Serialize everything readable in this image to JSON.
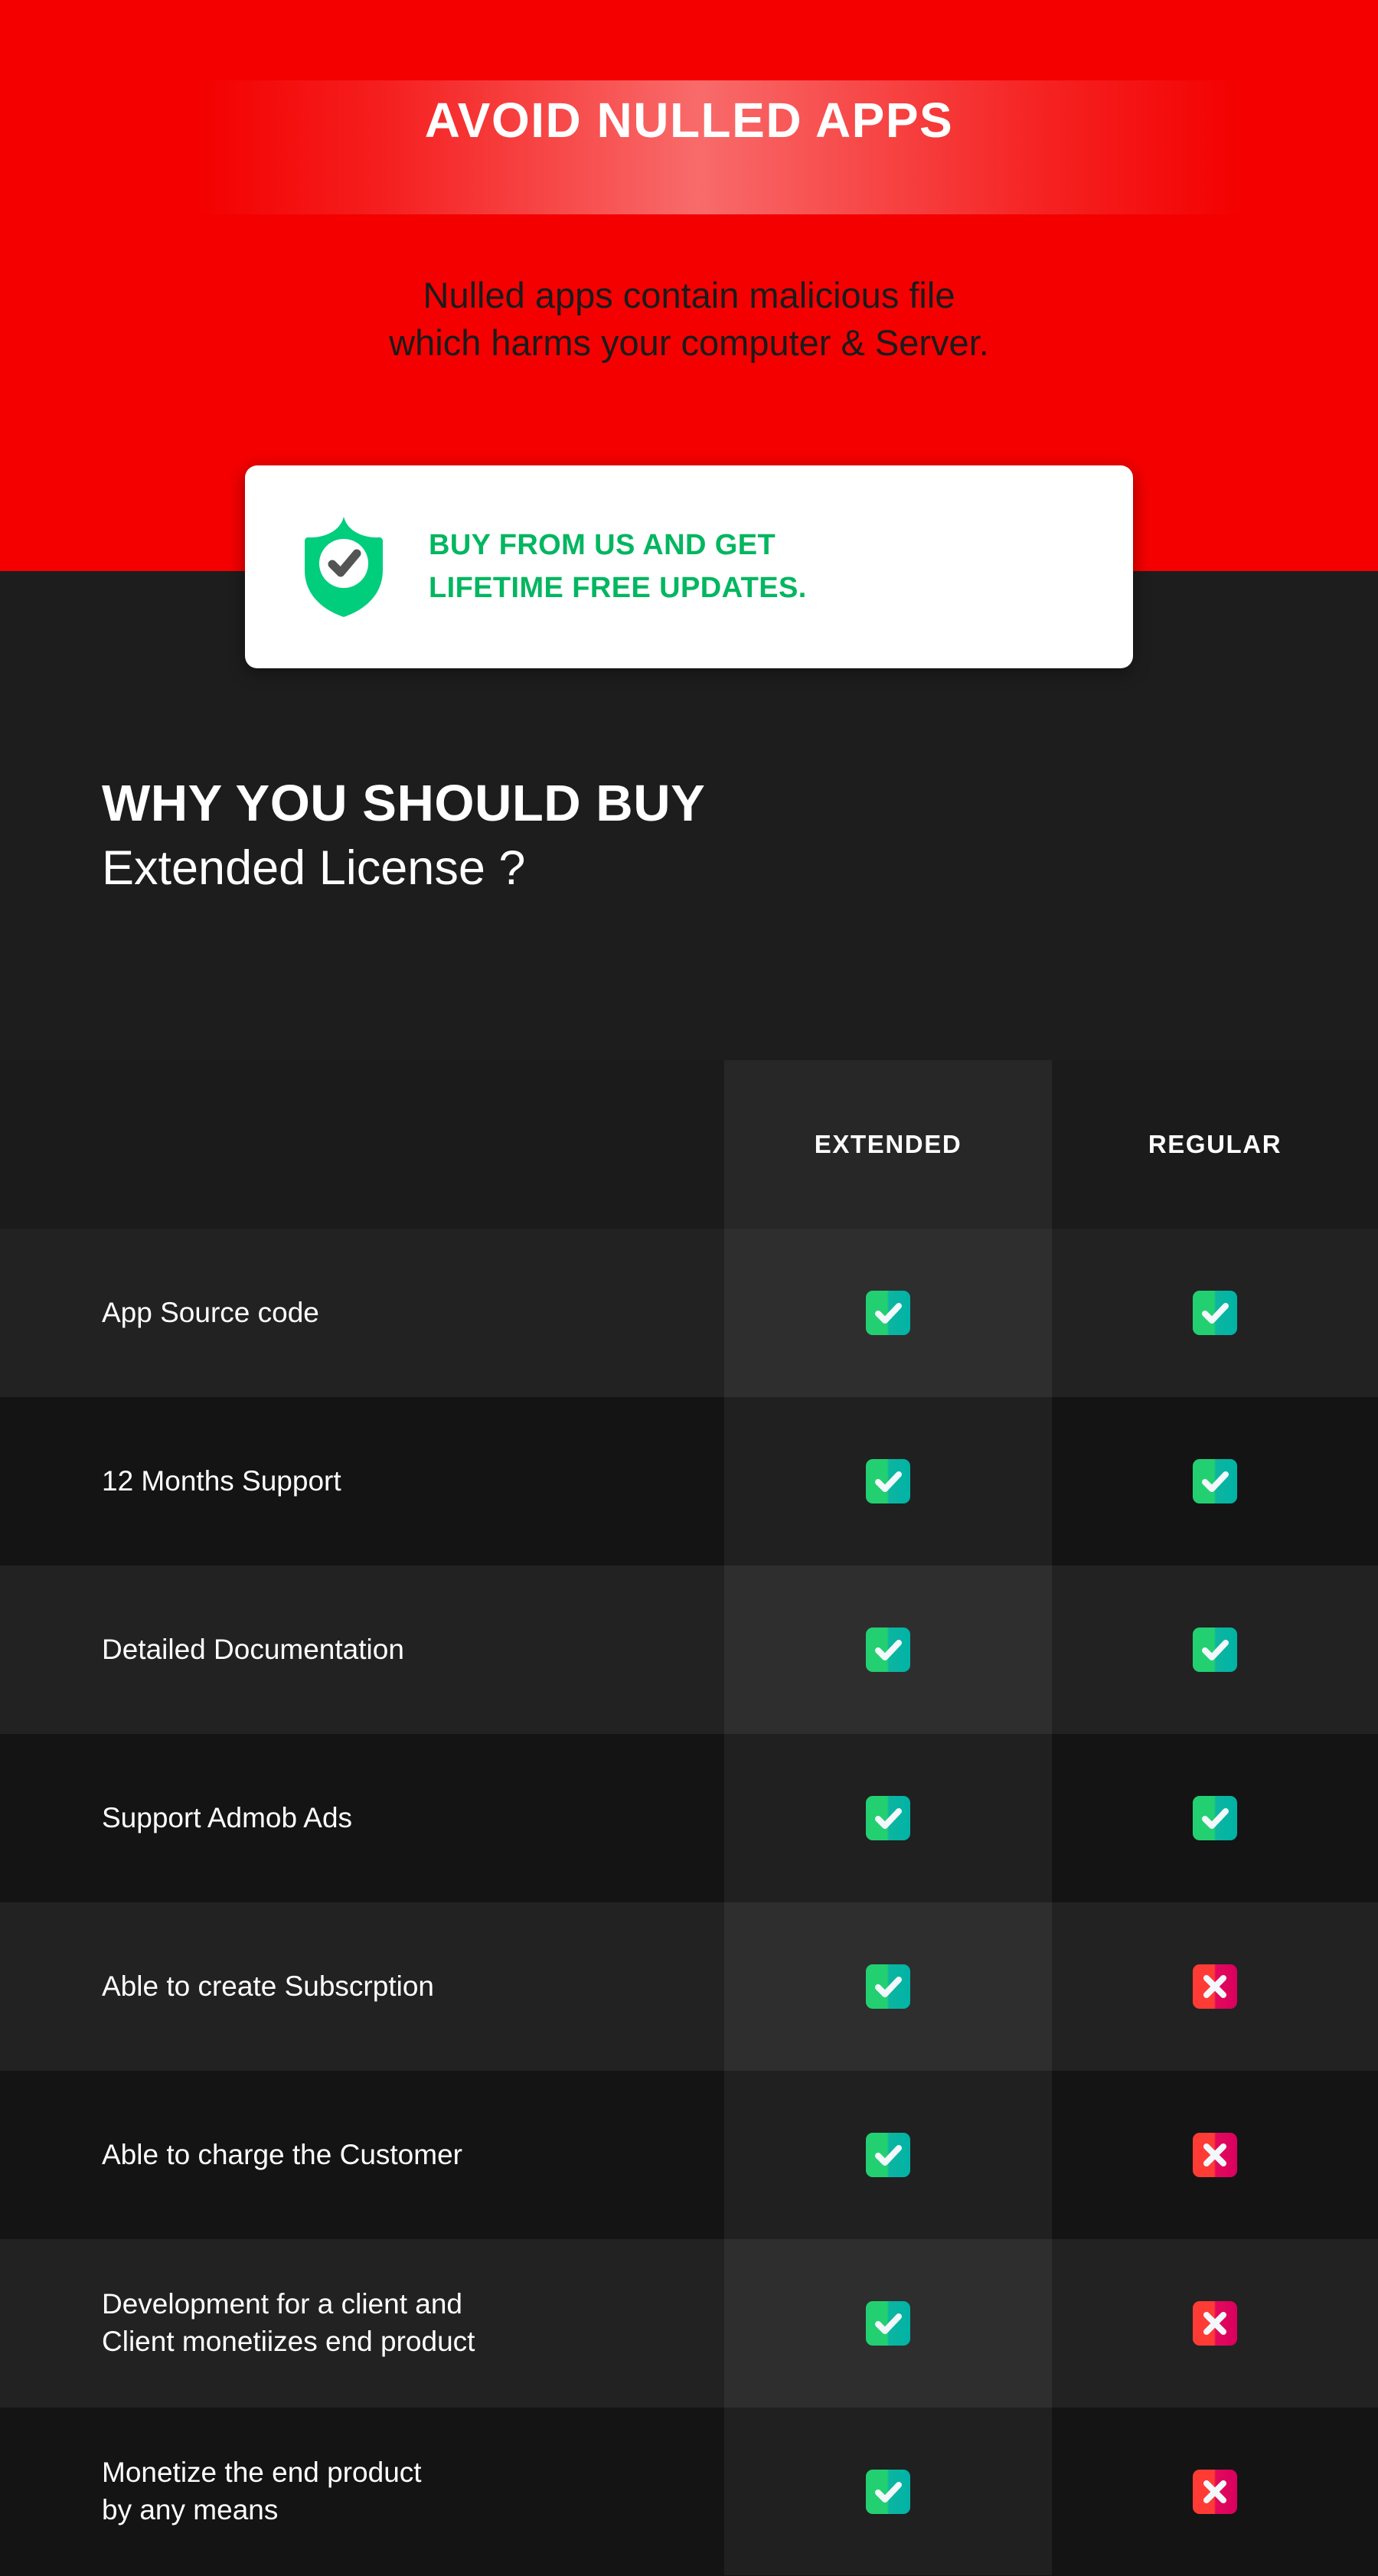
{
  "hero": {
    "title": "AVOID NULLED APPS",
    "subtitle_line1": "Nulled apps contain malicious file",
    "subtitle_line2": "which harms your computer & Server.",
    "bg_color": "#F40000",
    "title_color": "#FFFFFF",
    "subtitle_color": "#1B1B1B"
  },
  "promo_card": {
    "icon": "shield-check-icon",
    "line1": "BUY FROM US AND GET",
    "line2": "LIFETIME FREE UPDATES.",
    "text_color": "#03B660",
    "shield_color": "#00CE7C",
    "card_bg": "#FFFFFF"
  },
  "section": {
    "heading_line1": "WHY YOU SHOULD BUY",
    "heading_line2": "Extended License ?",
    "bg_color": "#1D1D1D"
  },
  "table": {
    "columns": [
      "",
      "EXTENDED",
      "REGULAR"
    ],
    "highlight_column": "EXTENDED",
    "yes_icon": "check-square-icon",
    "no_icon": "cross-square-icon",
    "yes_color": "#23D071",
    "no_color": "#FF3B35",
    "rows": [
      {
        "label": "App Source code",
        "extended": "yes",
        "regular": "yes"
      },
      {
        "label": "12 Months Support",
        "extended": "yes",
        "regular": "yes"
      },
      {
        "label": "Detailed Documentation",
        "extended": "yes",
        "regular": "yes"
      },
      {
        "label": "Support Admob Ads",
        "extended": "yes",
        "regular": "yes"
      },
      {
        "label": "Able to create Subscrption",
        "extended": "yes",
        "regular": "no"
      },
      {
        "label": "Able to charge the Customer",
        "extended": "yes",
        "regular": "no"
      },
      {
        "label": "Development for a client and\nClient monetiizes end product",
        "extended": "yes",
        "regular": "no"
      },
      {
        "label": "Monetize the end product\nby any means",
        "extended": "yes",
        "regular": "no"
      }
    ]
  }
}
